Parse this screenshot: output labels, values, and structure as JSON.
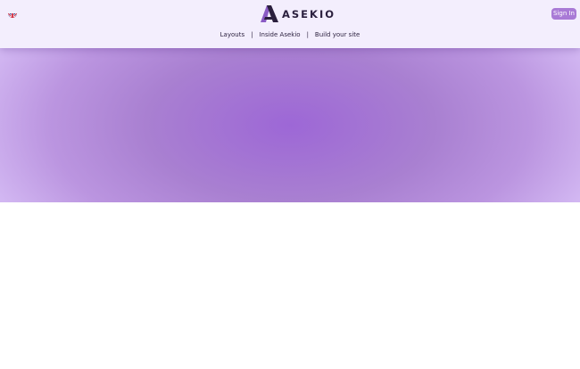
{
  "header": {
    "logo_text": "ASEKIO",
    "language_icon": "uk-flag-icon",
    "signin_label": "Sign In"
  },
  "nav": {
    "items": [
      {
        "label": "Layouts"
      },
      {
        "label": "Inside Asekio"
      },
      {
        "label": "Build your site"
      }
    ],
    "separator": "|"
  },
  "colors": {
    "header_bg": "#f3eefd",
    "accent": "#a97ad6",
    "hero_center": "#9d67d6",
    "hero_edge": "#d2b7f2",
    "text_dark": "#2a1f3d"
  }
}
